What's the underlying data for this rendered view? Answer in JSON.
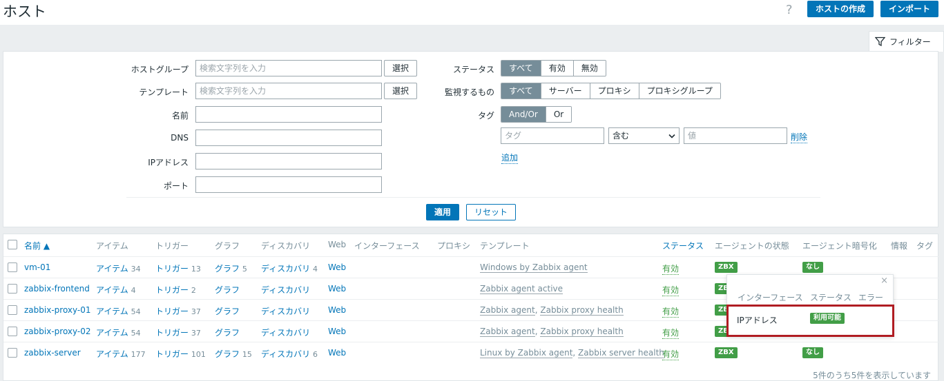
{
  "header": {
    "title": "ホスト",
    "help": "?",
    "create_host": "ホストの作成",
    "import": "インポート"
  },
  "filter": {
    "tab_label": "フィルター",
    "host_group_label": "ホストグループ",
    "host_group_placeholder": "検索文字列を入力",
    "template_label": "テンプレート",
    "template_placeholder": "検索文字列を入力",
    "select_label": "選択",
    "name_label": "名前",
    "dns_label": "DNS",
    "ip_label": "IPアドレス",
    "port_label": "ポート",
    "status_label": "ステータス",
    "status_options": [
      "すべて",
      "有効",
      "無効"
    ],
    "monitored_label": "監視するもの",
    "monitored_options": [
      "すべて",
      "サーバー",
      "プロキシ",
      "プロキシグループ"
    ],
    "tag_label": "タグ",
    "tag_mode_options": [
      "And/Or",
      "Or"
    ],
    "tag_placeholder": "タグ",
    "tag_operator": "含む",
    "tag_value_placeholder": "値",
    "remove": "削除",
    "add": "追加",
    "apply": "適用",
    "reset": "リセット"
  },
  "table": {
    "headers": {
      "name": "名前 ▲",
      "items": "アイテム",
      "triggers": "トリガー",
      "graphs": "グラフ",
      "discovery": "ディスカバリ",
      "web": "Web",
      "interface": "インターフェース",
      "proxy": "プロキシ",
      "templates": "テンプレート",
      "status": "ステータス",
      "agent_state": "エージェントの状態",
      "agent_encryption": "エージェント暗号化",
      "info": "情報",
      "tags": "タグ"
    },
    "rows": [
      {
        "name": "vm-01",
        "items": "アイテム",
        "items_count": "34",
        "triggers": "トリガー",
        "triggers_count": "13",
        "graphs": "グラフ",
        "graphs_count": "5",
        "discovery": "ディスカバリ",
        "discovery_count": "4",
        "web": "Web",
        "templates": [
          "Windows by Zabbix agent"
        ],
        "status": "有効",
        "agent": "ZBX",
        "encryption": "なし"
      },
      {
        "name": "zabbix-frontend",
        "items": "アイテム",
        "items_count": "4",
        "triggers": "トリガー",
        "triggers_count": "2",
        "graphs": "グラフ",
        "graphs_count": "",
        "discovery": "ディスカバリ",
        "discovery_count": "",
        "web": "Web",
        "templates": [
          "Zabbix agent active"
        ],
        "status": "有効",
        "agent": "ZBX",
        "encryption": ""
      },
      {
        "name": "zabbix-proxy-01",
        "items": "アイテム",
        "items_count": "54",
        "triggers": "トリガー",
        "triggers_count": "37",
        "graphs": "グラフ",
        "graphs_count": "",
        "discovery": "ディスカバリ",
        "discovery_count": "",
        "web": "Web",
        "templates": [
          "Zabbix agent",
          "Zabbix proxy health"
        ],
        "status": "有効",
        "agent": "ZBX",
        "encryption": ""
      },
      {
        "name": "zabbix-proxy-02",
        "items": "アイテム",
        "items_count": "54",
        "triggers": "トリガー",
        "triggers_count": "37",
        "graphs": "グラフ",
        "graphs_count": "",
        "discovery": "ディスカバリ",
        "discovery_count": "",
        "web": "Web",
        "templates": [
          "Zabbix agent",
          "Zabbix proxy health"
        ],
        "status": "有効",
        "agent": "ZBX",
        "encryption": ""
      },
      {
        "name": "zabbix-server",
        "items": "アイテム",
        "items_count": "177",
        "triggers": "トリガー",
        "triggers_count": "101",
        "graphs": "グラフ",
        "graphs_count": "15",
        "discovery": "ディスカバリ",
        "discovery_count": "6",
        "web": "Web",
        "templates": [
          "Linux by Zabbix agent",
          "Zabbix server health"
        ],
        "status": "有効",
        "agent": "ZBX",
        "encryption": "なし"
      }
    ],
    "footer": "5件のうち5件を表示しています"
  },
  "popup": {
    "close": "×",
    "headers": [
      "インターフェース",
      "ステータス",
      "エラー"
    ],
    "row": {
      "interface": "IPアドレス",
      "status": "利用可能"
    }
  },
  "colors": {
    "primary": "#0275b8",
    "success": "#429e47",
    "highlight": "#b01c22",
    "segment_active": "#768d99"
  }
}
